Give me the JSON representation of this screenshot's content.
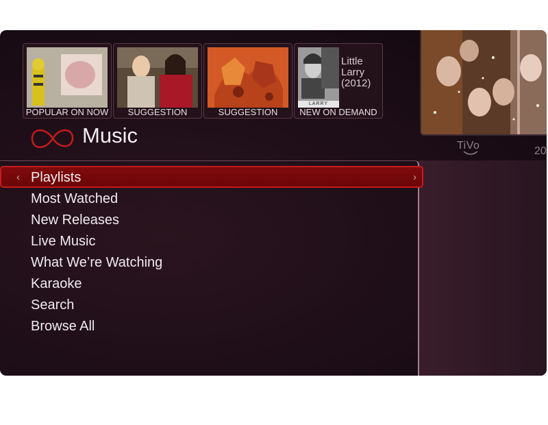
{
  "strip": {
    "tiles": [
      {
        "caption": "POPULAR ON NOW"
      },
      {
        "caption": "SUGGESTION"
      },
      {
        "caption": "SUGGESTION"
      },
      {
        "caption": "NEW ON DEMAND",
        "title_line1": "Little",
        "title_line2": "Larry",
        "title_line3": "(2012)",
        "poster_text": "LARRY"
      }
    ]
  },
  "header": {
    "title": "Music"
  },
  "brand": {
    "tivo": "TiVo",
    "corner_number": "20"
  },
  "menu": {
    "selected": "Playlists",
    "items": [
      "Most Watched",
      "New Releases",
      "Live Music",
      "What We’re Watching",
      "Karaoke",
      "Search",
      "Browse All"
    ]
  },
  "colors": {
    "accent": "#c51b1b",
    "selection_bg": "#7f0b0d",
    "background": "#1c0d16"
  }
}
